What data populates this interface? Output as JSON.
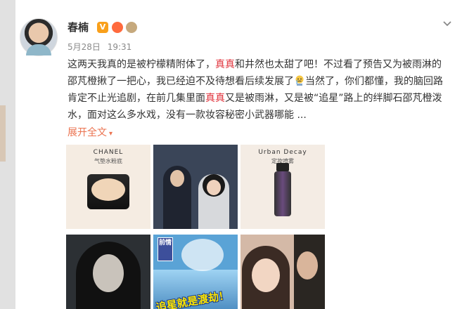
{
  "user": {
    "name": "春楠",
    "verified_badge": "V"
  },
  "meta": {
    "date": "5月28日",
    "time": "19:31"
  },
  "post": {
    "seg1": "这两天我真的是被柠檬精附体了，",
    "hl1": "真真",
    "seg2": "和井然也太甜了吧！不过看了预告又为被雨淋的邵芃橙揪了一把心，我已经迫不及待想看后续发展了",
    "seg3": "当然了，你们都懂，我的脑回路肯定不止光追剧，在前几集里面",
    "hl2": "真真",
    "seg4": "又是被雨淋，又是被“追星”路上的绊脚石邵芃橙泼水，面对这么多水戏，没有一款妆容秘密小武器哪能 ..."
  },
  "expand_label": "展开全文",
  "images": {
    "chanel_brand": "CHANEL",
    "chanel_product": "气垫水粉底",
    "urban_brand": "Urban Decay",
    "urban_product": "定妆喷雾",
    "tag_text": "前情",
    "overlay_text": "追星就是渡劫！"
  },
  "colors": {
    "highlight": "#e0323b",
    "link": "#eb7350"
  },
  "icons": {
    "dropdown": "chevron-down-icon",
    "crying": "crying-emoji-icon"
  }
}
